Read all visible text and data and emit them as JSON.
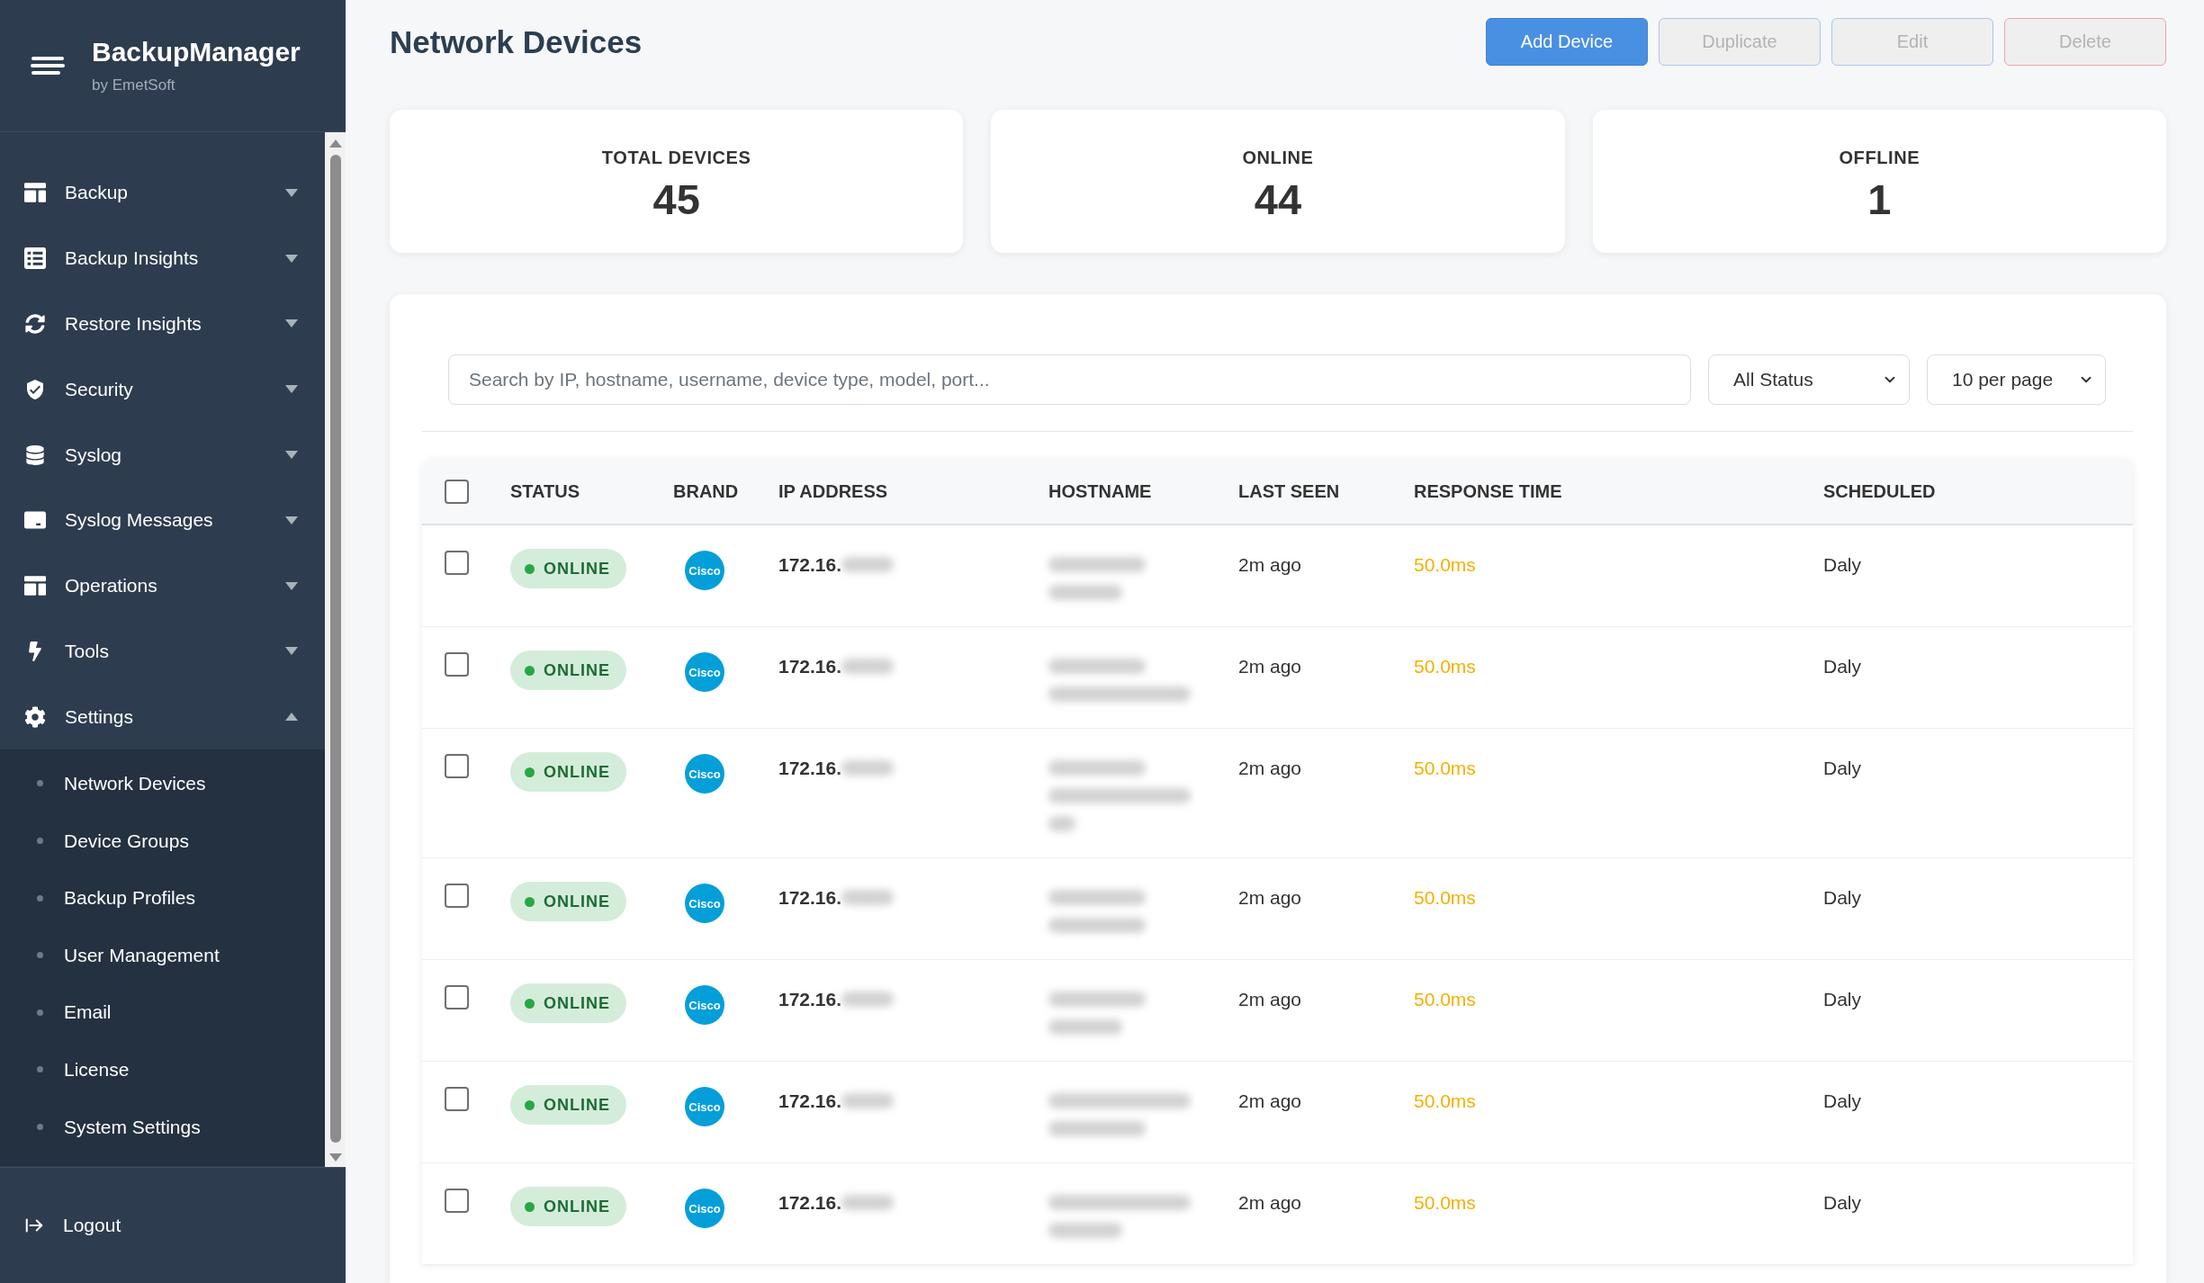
{
  "sidebar": {
    "brand": {
      "title": "BackupManager",
      "subtitle": "by EmetSoft"
    },
    "items": [
      {
        "label": "Backup",
        "expanded": false
      },
      {
        "label": "Backup Insights",
        "expanded": false
      },
      {
        "label": "Restore Insights",
        "expanded": false
      },
      {
        "label": "Security",
        "expanded": false
      },
      {
        "label": "Syslog",
        "expanded": false
      },
      {
        "label": "Syslog Messages",
        "expanded": false
      },
      {
        "label": "Operations",
        "expanded": false
      },
      {
        "label": "Tools",
        "expanded": false
      },
      {
        "label": "Settings",
        "expanded": true,
        "children": [
          {
            "label": "Network Devices"
          },
          {
            "label": "Device Groups"
          },
          {
            "label": "Backup Profiles"
          },
          {
            "label": "User Management"
          },
          {
            "label": "Email"
          },
          {
            "label": "License"
          },
          {
            "label": "System Settings"
          }
        ]
      }
    ],
    "logout": "Logout"
  },
  "header": {
    "title": "Network Devices",
    "actions": [
      {
        "label": "Add Device",
        "kind": "primary",
        "disabled": false
      },
      {
        "label": "Duplicate",
        "kind": "secondary",
        "disabled": true
      },
      {
        "label": "Edit",
        "kind": "secondary",
        "disabled": true
      },
      {
        "label": "Delete",
        "kind": "danger",
        "disabled": true
      }
    ]
  },
  "stats": [
    {
      "label": "TOTAL DEVICES",
      "value": "45"
    },
    {
      "label": "ONLINE",
      "value": "44"
    },
    {
      "label": "OFFLINE",
      "value": "1"
    }
  ],
  "filters": {
    "search": {
      "placeholder": "Search by IP, hostname, username, device type, model, port..."
    },
    "status_select": {
      "value": "All Status"
    },
    "page_size_select": {
      "value": "10 per page"
    }
  },
  "table": {
    "select_all": {
      "checked": false
    },
    "columns": [
      "STATUS",
      "BRAND",
      "IP ADDRESS",
      "HOSTNAME",
      "LAST SEEN",
      "RESPONSE TIME",
      "SCHEDULED"
    ],
    "rows": [
      {
        "checked": false,
        "status": {
          "label": "ONLINE",
          "color": "#28a745"
        },
        "brand": "Cisco",
        "ip": "172.16.",
        "ip_redacted": true,
        "hostname_blur": [
          {
            "kind": "medium"
          },
          {
            "kind": "short"
          }
        ],
        "last_seen": "2m ago",
        "response_time": "50.0ms",
        "scheduled": "Daly"
      },
      {
        "checked": false,
        "status": {
          "label": "ONLINE",
          "color": "#28a745"
        },
        "brand": "Cisco",
        "ip": "172.16.",
        "ip_redacted": true,
        "hostname_blur": [
          {
            "kind": "medium"
          },
          {
            "kind": "long"
          }
        ],
        "last_seen": "2m ago",
        "response_time": "50.0ms",
        "scheduled": "Daly"
      },
      {
        "checked": false,
        "status": {
          "label": "ONLINE",
          "color": "#28a745"
        },
        "brand": "Cisco",
        "ip": "172.16.",
        "ip_redacted": true,
        "hostname_blur": [
          {
            "kind": "medium"
          },
          {
            "kind": "long"
          },
          {
            "kind": "tiny"
          }
        ],
        "last_seen": "2m ago",
        "response_time": "50.0ms",
        "scheduled": "Daly"
      },
      {
        "checked": false,
        "status": {
          "label": "ONLINE",
          "color": "#28a745"
        },
        "brand": "Cisco",
        "ip": "172.16.",
        "ip_redacted": true,
        "hostname_blur": [
          {
            "kind": "medium"
          },
          {
            "kind": "medium"
          }
        ],
        "last_seen": "2m ago",
        "response_time": "50.0ms",
        "scheduled": "Daly"
      },
      {
        "checked": false,
        "status": {
          "label": "ONLINE",
          "color": "#28a745"
        },
        "brand": "Cisco",
        "ip": "172.16.",
        "ip_redacted": true,
        "hostname_blur": [
          {
            "kind": "medium"
          },
          {
            "kind": "short"
          }
        ],
        "last_seen": "2m ago",
        "response_time": "50.0ms",
        "scheduled": "Daly"
      },
      {
        "checked": false,
        "status": {
          "label": "ONLINE",
          "color": "#28a745"
        },
        "brand": "Cisco",
        "ip": "172.16.",
        "ip_redacted": true,
        "hostname_blur": [
          {
            "kind": "long"
          },
          {
            "kind": "medium"
          }
        ],
        "last_seen": "2m ago",
        "response_time": "50.0ms",
        "scheduled": "Daly"
      },
      {
        "checked": false,
        "status": {
          "label": "ONLINE",
          "color": "#28a745"
        },
        "brand": "Cisco",
        "ip": "172.16.",
        "ip_redacted": true,
        "hostname_blur": [
          {
            "kind": "long"
          },
          {
            "kind": "short"
          }
        ],
        "last_seen": "2m ago",
        "response_time": "50.0ms",
        "scheduled": "Daly"
      }
    ]
  }
}
